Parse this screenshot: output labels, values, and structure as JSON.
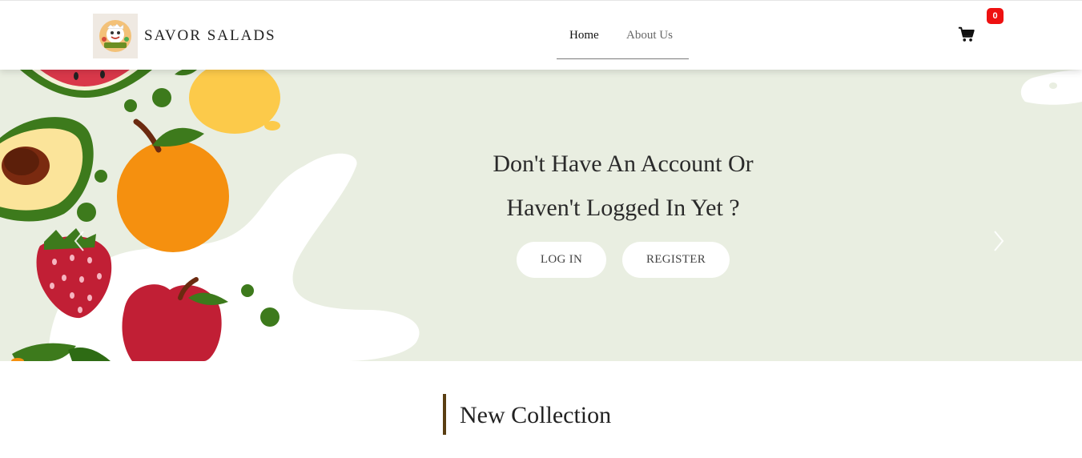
{
  "header": {
    "logo_alt": "Savor Salads logo",
    "brand": "SAVOR SALADS",
    "nav": [
      {
        "label": "Home",
        "active": true
      },
      {
        "label": "About Us",
        "active": false
      }
    ],
    "cart": {
      "icon": "cart-icon",
      "count": "0",
      "badge_color": "#ee1111"
    }
  },
  "hero": {
    "title_line1": "Don't Have An Account Or",
    "title_line2": "Haven't Logged In Yet ?",
    "login_label": "LOG IN",
    "register_label": "REGISTER",
    "background": "#e9eee1",
    "prev_icon": "chevron-left-icon",
    "next_icon": "chevron-right-icon"
  },
  "section": {
    "title": "New Collection",
    "accent": "#5a3e12"
  }
}
